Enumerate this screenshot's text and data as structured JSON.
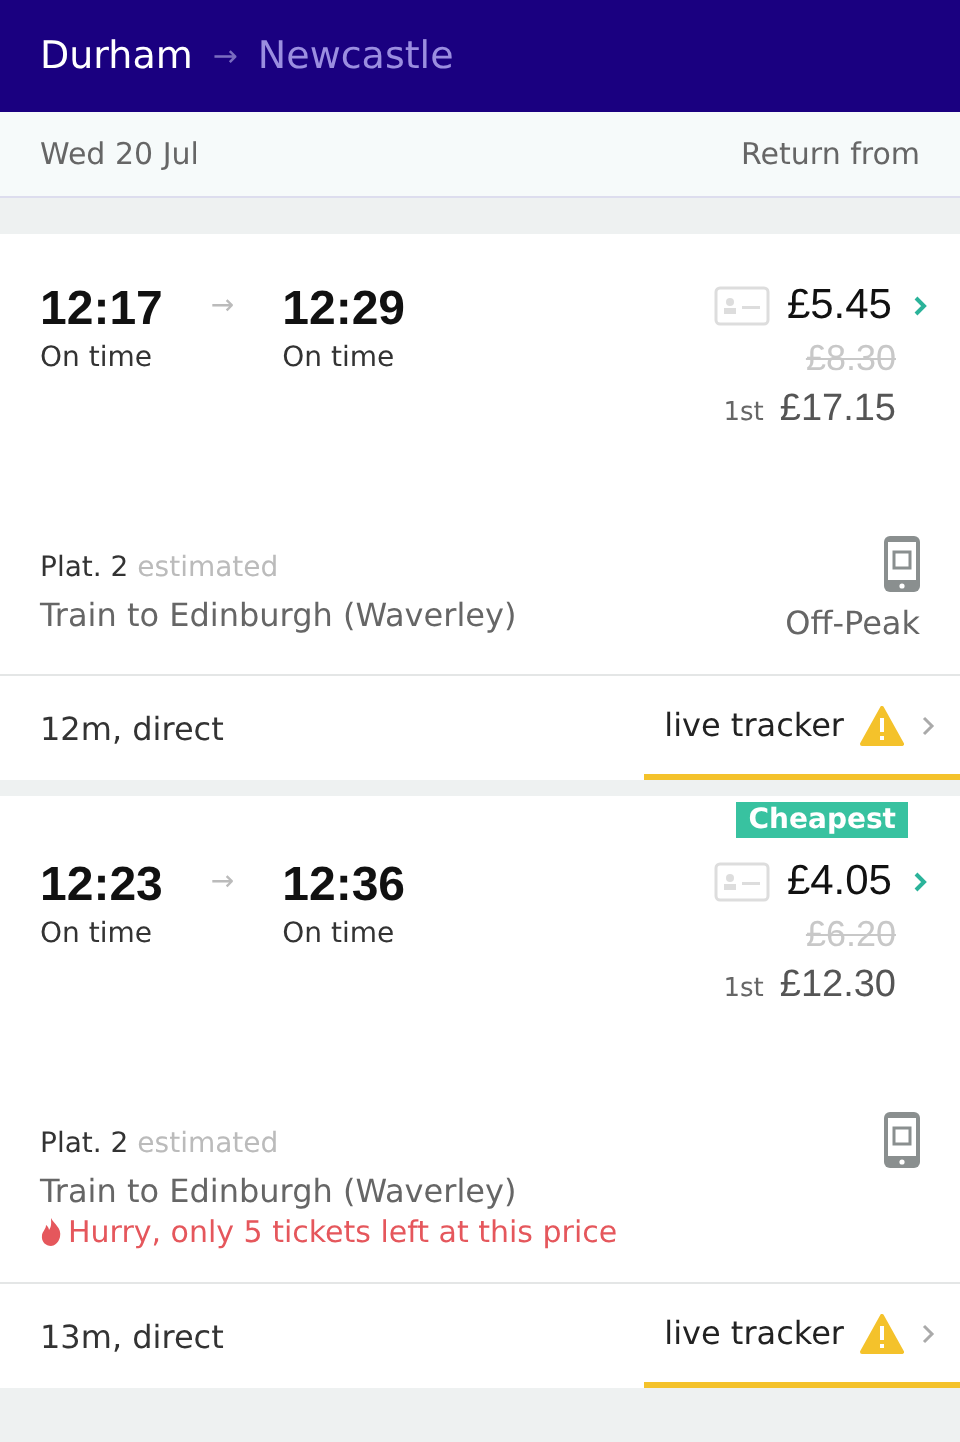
{
  "header": {
    "origin": "Durham",
    "arrow": "→",
    "destination": "Newcastle"
  },
  "subheader": {
    "date": "Wed 20 Jul",
    "return_label": "Return from"
  },
  "journeys": [
    {
      "depart": "12:17",
      "depart_status": "On time",
      "arrow": "→",
      "arrive": "12:29",
      "arrive_status": "On time",
      "price": "£5.45",
      "old_price": "£8.30",
      "first_label": "1st",
      "first_price": "£17.15",
      "platform": "Plat. 2",
      "platform_note": "estimated",
      "service": "Train to Edinburgh (Waverley)",
      "fare_type": "Off-Peak",
      "duration": "12m, direct",
      "tracker": "live tracker"
    },
    {
      "badge": "Cheapest",
      "depart": "12:23",
      "depart_status": "On time",
      "arrow": "→",
      "arrive": "12:36",
      "arrive_status": "On time",
      "price": "£4.05",
      "old_price": "£6.20",
      "first_label": "1st",
      "first_price": "£12.30",
      "platform": "Plat. 2",
      "platform_note": "estimated",
      "service": "Train to Edinburgh (Waverley)",
      "warning": "Hurry, only 5 tickets left at this price",
      "duration": "13m, direct",
      "tracker": "live tracker"
    }
  ]
}
